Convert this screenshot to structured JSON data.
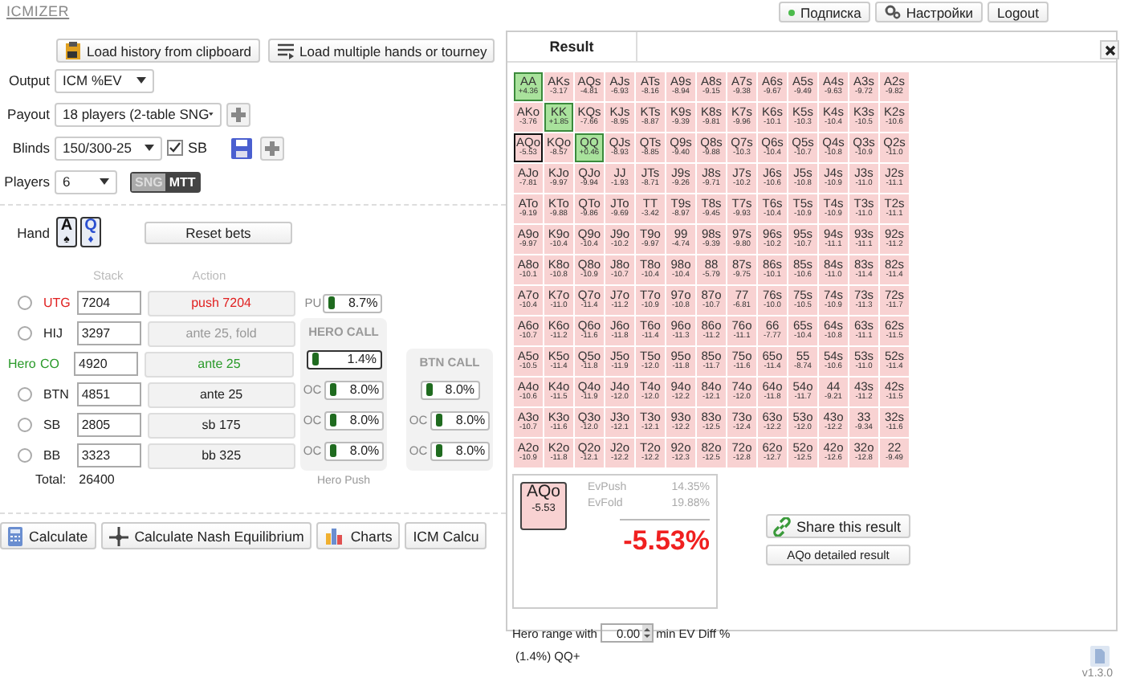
{
  "app_title": "ICMIZER",
  "top_buttons": [
    {
      "label": "Подписка",
      "kind": "status"
    },
    {
      "label": "Настройки",
      "kind": "settings"
    },
    {
      "label": "Logout",
      "kind": "plain"
    }
  ],
  "load_buttons": [
    {
      "label": "Load history from clipboard",
      "kind": "clipboard"
    },
    {
      "label": "Load multiple hands or tourney",
      "kind": "list"
    }
  ],
  "settings": {
    "output": {
      "label": "Output",
      "value": "ICM %EV"
    },
    "payout": {
      "label": "Payout",
      "value": "18 players (2-table SNG"
    },
    "blinds": {
      "label": "Blinds",
      "value": "150/300-25",
      "sb_label": "SB",
      "sb_checked": true
    },
    "players": {
      "label": "Players",
      "value": "6"
    },
    "mode": [
      {
        "label": "SNG",
        "selected": false
      },
      {
        "label": "MTT",
        "selected": true
      }
    ]
  },
  "hand": {
    "label": "Hand",
    "cards": [
      {
        "rank": "A",
        "suit": "♠",
        "color": "#111111"
      },
      {
        "rank": "Q",
        "suit": "♦",
        "color": "#2a4fd0"
      }
    ]
  },
  "reset_button": "Reset bets",
  "table_headers": {
    "stack": "Stack",
    "action": "Action"
  },
  "players": [
    {
      "position": "UTG",
      "stack": "7204",
      "action": "push 7204",
      "pushed": true,
      "folded": false,
      "selected": false
    },
    {
      "position": "HIJ",
      "stack": "3297",
      "action": "ante 25, fold",
      "pushed": false,
      "folded": true,
      "selected": false
    },
    {
      "position": "CO",
      "stack": "4920",
      "action": "ante 25",
      "pushed": false,
      "folded": false,
      "hero_label": "Hero"
    },
    {
      "position": "BTN",
      "stack": "4851",
      "action": "ante 25",
      "pushed": false,
      "folded": false,
      "selected": false
    },
    {
      "position": "SB",
      "stack": "2805",
      "action": "sb 175",
      "pushed": false,
      "folded": false,
      "selected": false
    },
    {
      "position": "BB",
      "stack": "3323",
      "action": "bb 325",
      "pushed": false,
      "folded": false,
      "selected": false
    }
  ],
  "push_indicator": {
    "label": "PU",
    "value": "8.7%"
  },
  "total": {
    "label": "Total:",
    "value": "26400"
  },
  "call_panels": [
    {
      "title": "HERO CALL",
      "footer": "Hero Push",
      "rows": [
        {
          "label": null,
          "value": "1.4%",
          "hero": true
        },
        {
          "label": "OC",
          "value": "8.0%",
          "hero": false
        },
        {
          "label": "OC",
          "value": "8.0%",
          "hero": false
        },
        {
          "label": "OC",
          "value": "8.0%",
          "hero": false
        }
      ]
    },
    {
      "title": "BTN CALL",
      "rows": [
        {
          "label": null,
          "value": "8.0%",
          "hero": false
        },
        {
          "label": "OC",
          "value": "8.0%",
          "hero": false
        },
        {
          "label": "OC",
          "value": "8.0%",
          "hero": false
        }
      ]
    }
  ],
  "bottom_buttons": [
    {
      "label": "Calculate",
      "kind": "calculator"
    },
    {
      "label": "Calculate Nash Equilibrium",
      "kind": "nash"
    },
    {
      "label": "Charts",
      "kind": "chart"
    },
    {
      "label": "ICM Calcu",
      "kind": "plain"
    }
  ],
  "result": {
    "tab": "Result",
    "grid": [
      [
        {
          "hand": "AA",
          "ev": "+4.36",
          "in_range": true,
          "selected": false
        },
        {
          "hand": "AKs",
          "ev": "-3.17",
          "in_range": false,
          "selected": false
        },
        {
          "hand": "AQs",
          "ev": "-4.81",
          "in_range": false,
          "selected": false
        },
        {
          "hand": "AJs",
          "ev": "-6.93",
          "in_range": false,
          "selected": false
        },
        {
          "hand": "ATs",
          "ev": "-8.16",
          "in_range": false,
          "selected": false
        },
        {
          "hand": "A9s",
          "ev": "-8.94",
          "in_range": false,
          "selected": false
        },
        {
          "hand": "A8s",
          "ev": "-9.15",
          "in_range": false,
          "selected": false
        },
        {
          "hand": "A7s",
          "ev": "-9.38",
          "in_range": false,
          "selected": false
        },
        {
          "hand": "A6s",
          "ev": "-9.67",
          "in_range": false,
          "selected": false
        },
        {
          "hand": "A5s",
          "ev": "-9.49",
          "in_range": false,
          "selected": false
        },
        {
          "hand": "A4s",
          "ev": "-9.63",
          "in_range": false,
          "selected": false
        },
        {
          "hand": "A3s",
          "ev": "-9.72",
          "in_range": false,
          "selected": false
        },
        {
          "hand": "A2s",
          "ev": "-9.82",
          "in_range": false,
          "selected": false
        }
      ],
      [
        {
          "hand": "AKo",
          "ev": "-3.76",
          "in_range": false,
          "selected": false
        },
        {
          "hand": "KK",
          "ev": "+1.85",
          "in_range": true,
          "selected": false
        },
        {
          "hand": "KQs",
          "ev": "-7.66",
          "in_range": false,
          "selected": false
        },
        {
          "hand": "KJs",
          "ev": "-8.95",
          "in_range": false,
          "selected": false
        },
        {
          "hand": "KTs",
          "ev": "-8.87",
          "in_range": false,
          "selected": false
        },
        {
          "hand": "K9s",
          "ev": "-9.39",
          "in_range": false,
          "selected": false
        },
        {
          "hand": "K8s",
          "ev": "-9.81",
          "in_range": false,
          "selected": false
        },
        {
          "hand": "K7s",
          "ev": "-9.96",
          "in_range": false,
          "selected": false
        },
        {
          "hand": "K6s",
          "ev": "-10.1",
          "in_range": false,
          "selected": false
        },
        {
          "hand": "K5s",
          "ev": "-10.3",
          "in_range": false,
          "selected": false
        },
        {
          "hand": "K4s",
          "ev": "-10.4",
          "in_range": false,
          "selected": false
        },
        {
          "hand": "K3s",
          "ev": "-10.5",
          "in_range": false,
          "selected": false
        },
        {
          "hand": "K2s",
          "ev": "-10.6",
          "in_range": false,
          "selected": false
        }
      ],
      [
        {
          "hand": "AQo",
          "ev": "-5.53",
          "in_range": false,
          "selected": true
        },
        {
          "hand": "KQo",
          "ev": "-8.57",
          "in_range": false,
          "selected": false
        },
        {
          "hand": "QQ",
          "ev": "+0.46",
          "in_range": true,
          "selected": false
        },
        {
          "hand": "QJs",
          "ev": "-8.93",
          "in_range": false,
          "selected": false
        },
        {
          "hand": "QTs",
          "ev": "-8.85",
          "in_range": false,
          "selected": false
        },
        {
          "hand": "Q9s",
          "ev": "-9.40",
          "in_range": false,
          "selected": false
        },
        {
          "hand": "Q8s",
          "ev": "-9.88",
          "in_range": false,
          "selected": false
        },
        {
          "hand": "Q7s",
          "ev": "-10.3",
          "in_range": false,
          "selected": false
        },
        {
          "hand": "Q6s",
          "ev": "-10.4",
          "in_range": false,
          "selected": false
        },
        {
          "hand": "Q5s",
          "ev": "-10.7",
          "in_range": false,
          "selected": false
        },
        {
          "hand": "Q4s",
          "ev": "-10.8",
          "in_range": false,
          "selected": false
        },
        {
          "hand": "Q3s",
          "ev": "-10.9",
          "in_range": false,
          "selected": false
        },
        {
          "hand": "Q2s",
          "ev": "-11.0",
          "in_range": false,
          "selected": false
        }
      ],
      [
        {
          "hand": "AJo",
          "ev": "-7.81",
          "in_range": false,
          "selected": false
        },
        {
          "hand": "KJo",
          "ev": "-9.97",
          "in_range": false,
          "selected": false
        },
        {
          "hand": "QJo",
          "ev": "-9.94",
          "in_range": false,
          "selected": false
        },
        {
          "hand": "JJ",
          "ev": "-1.93",
          "in_range": false,
          "selected": false
        },
        {
          "hand": "JTs",
          "ev": "-8.71",
          "in_range": false,
          "selected": false
        },
        {
          "hand": "J9s",
          "ev": "-9.26",
          "in_range": false,
          "selected": false
        },
        {
          "hand": "J8s",
          "ev": "-9.71",
          "in_range": false,
          "selected": false
        },
        {
          "hand": "J7s",
          "ev": "-10.2",
          "in_range": false,
          "selected": false
        },
        {
          "hand": "J6s",
          "ev": "-10.6",
          "in_range": false,
          "selected": false
        },
        {
          "hand": "J5s",
          "ev": "-10.8",
          "in_range": false,
          "selected": false
        },
        {
          "hand": "J4s",
          "ev": "-10.9",
          "in_range": false,
          "selected": false
        },
        {
          "hand": "J3s",
          "ev": "-11.0",
          "in_range": false,
          "selected": false
        },
        {
          "hand": "J2s",
          "ev": "-11.1",
          "in_range": false,
          "selected": false
        }
      ],
      [
        {
          "hand": "ATo",
          "ev": "-9.19",
          "in_range": false,
          "selected": false
        },
        {
          "hand": "KTo",
          "ev": "-9.88",
          "in_range": false,
          "selected": false
        },
        {
          "hand": "QTo",
          "ev": "-9.86",
          "in_range": false,
          "selected": false
        },
        {
          "hand": "JTo",
          "ev": "-9.69",
          "in_range": false,
          "selected": false
        },
        {
          "hand": "TT",
          "ev": "-3.42",
          "in_range": false,
          "selected": false
        },
        {
          "hand": "T9s",
          "ev": "-8.97",
          "in_range": false,
          "selected": false
        },
        {
          "hand": "T8s",
          "ev": "-9.45",
          "in_range": false,
          "selected": false
        },
        {
          "hand": "T7s",
          "ev": "-9.93",
          "in_range": false,
          "selected": false
        },
        {
          "hand": "T6s",
          "ev": "-10.4",
          "in_range": false,
          "selected": false
        },
        {
          "hand": "T5s",
          "ev": "-10.9",
          "in_range": false,
          "selected": false
        },
        {
          "hand": "T4s",
          "ev": "-10.9",
          "in_range": false,
          "selected": false
        },
        {
          "hand": "T3s",
          "ev": "-11.0",
          "in_range": false,
          "selected": false
        },
        {
          "hand": "T2s",
          "ev": "-11.1",
          "in_range": false,
          "selected": false
        }
      ],
      [
        {
          "hand": "A9o",
          "ev": "-9.97",
          "in_range": false,
          "selected": false
        },
        {
          "hand": "K9o",
          "ev": "-10.4",
          "in_range": false,
          "selected": false
        },
        {
          "hand": "Q9o",
          "ev": "-10.4",
          "in_range": false,
          "selected": false
        },
        {
          "hand": "J9o",
          "ev": "-10.2",
          "in_range": false,
          "selected": false
        },
        {
          "hand": "T9o",
          "ev": "-9.97",
          "in_range": false,
          "selected": false
        },
        {
          "hand": "99",
          "ev": "-4.74",
          "in_range": false,
          "selected": false
        },
        {
          "hand": "98s",
          "ev": "-9.39",
          "in_range": false,
          "selected": false
        },
        {
          "hand": "97s",
          "ev": "-9.80",
          "in_range": false,
          "selected": false
        },
        {
          "hand": "96s",
          "ev": "-10.2",
          "in_range": false,
          "selected": false
        },
        {
          "hand": "95s",
          "ev": "-10.7",
          "in_range": false,
          "selected": false
        },
        {
          "hand": "94s",
          "ev": "-11.1",
          "in_range": false,
          "selected": false
        },
        {
          "hand": "93s",
          "ev": "-11.1",
          "in_range": false,
          "selected": false
        },
        {
          "hand": "92s",
          "ev": "-11.2",
          "in_range": false,
          "selected": false
        }
      ],
      [
        {
          "hand": "A8o",
          "ev": "-10.1",
          "in_range": false,
          "selected": false
        },
        {
          "hand": "K8o",
          "ev": "-10.8",
          "in_range": false,
          "selected": false
        },
        {
          "hand": "Q8o",
          "ev": "-10.9",
          "in_range": false,
          "selected": false
        },
        {
          "hand": "J8o",
          "ev": "-10.7",
          "in_range": false,
          "selected": false
        },
        {
          "hand": "T8o",
          "ev": "-10.4",
          "in_range": false,
          "selected": false
        },
        {
          "hand": "98o",
          "ev": "-10.4",
          "in_range": false,
          "selected": false
        },
        {
          "hand": "88",
          "ev": "-5.79",
          "in_range": false,
          "selected": false
        },
        {
          "hand": "87s",
          "ev": "-9.75",
          "in_range": false,
          "selected": false
        },
        {
          "hand": "86s",
          "ev": "-10.1",
          "in_range": false,
          "selected": false
        },
        {
          "hand": "85s",
          "ev": "-10.6",
          "in_range": false,
          "selected": false
        },
        {
          "hand": "84s",
          "ev": "-11.0",
          "in_range": false,
          "selected": false
        },
        {
          "hand": "83s",
          "ev": "-11.4",
          "in_range": false,
          "selected": false
        },
        {
          "hand": "82s",
          "ev": "-11.4",
          "in_range": false,
          "selected": false
        }
      ],
      [
        {
          "hand": "A7o",
          "ev": "-10.4",
          "in_range": false,
          "selected": false
        },
        {
          "hand": "K7o",
          "ev": "-11.0",
          "in_range": false,
          "selected": false
        },
        {
          "hand": "Q7o",
          "ev": "-11.4",
          "in_range": false,
          "selected": false
        },
        {
          "hand": "J7o",
          "ev": "-11.2",
          "in_range": false,
          "selected": false
        },
        {
          "hand": "T7o",
          "ev": "-10.9",
          "in_range": false,
          "selected": false
        },
        {
          "hand": "97o",
          "ev": "-10.8",
          "in_range": false,
          "selected": false
        },
        {
          "hand": "87o",
          "ev": "-10.7",
          "in_range": false,
          "selected": false
        },
        {
          "hand": "77",
          "ev": "-6.81",
          "in_range": false,
          "selected": false
        },
        {
          "hand": "76s",
          "ev": "-10.0",
          "in_range": false,
          "selected": false
        },
        {
          "hand": "75s",
          "ev": "-10.5",
          "in_range": false,
          "selected": false
        },
        {
          "hand": "74s",
          "ev": "-10.9",
          "in_range": false,
          "selected": false
        },
        {
          "hand": "73s",
          "ev": "-11.3",
          "in_range": false,
          "selected": false
        },
        {
          "hand": "72s",
          "ev": "-11.7",
          "in_range": false,
          "selected": false
        }
      ],
      [
        {
          "hand": "A6o",
          "ev": "-10.7",
          "in_range": false,
          "selected": false
        },
        {
          "hand": "K6o",
          "ev": "-11.2",
          "in_range": false,
          "selected": false
        },
        {
          "hand": "Q6o",
          "ev": "-11.6",
          "in_range": false,
          "selected": false
        },
        {
          "hand": "J6o",
          "ev": "-11.8",
          "in_range": false,
          "selected": false
        },
        {
          "hand": "T6o",
          "ev": "-11.4",
          "in_range": false,
          "selected": false
        },
        {
          "hand": "96o",
          "ev": "-11.3",
          "in_range": false,
          "selected": false
        },
        {
          "hand": "86o",
          "ev": "-11.2",
          "in_range": false,
          "selected": false
        },
        {
          "hand": "76o",
          "ev": "-11.1",
          "in_range": false,
          "selected": false
        },
        {
          "hand": "66",
          "ev": "-7.77",
          "in_range": false,
          "selected": false
        },
        {
          "hand": "65s",
          "ev": "-10.4",
          "in_range": false,
          "selected": false
        },
        {
          "hand": "64s",
          "ev": "-10.8",
          "in_range": false,
          "selected": false
        },
        {
          "hand": "63s",
          "ev": "-11.1",
          "in_range": false,
          "selected": false
        },
        {
          "hand": "62s",
          "ev": "-11.5",
          "in_range": false,
          "selected": false
        }
      ],
      [
        {
          "hand": "A5o",
          "ev": "-10.5",
          "in_range": false,
          "selected": false
        },
        {
          "hand": "K5o",
          "ev": "-11.4",
          "in_range": false,
          "selected": false
        },
        {
          "hand": "Q5o",
          "ev": "-11.8",
          "in_range": false,
          "selected": false
        },
        {
          "hand": "J5o",
          "ev": "-11.9",
          "in_range": false,
          "selected": false
        },
        {
          "hand": "T5o",
          "ev": "-12.0",
          "in_range": false,
          "selected": false
        },
        {
          "hand": "95o",
          "ev": "-11.8",
          "in_range": false,
          "selected": false
        },
        {
          "hand": "85o",
          "ev": "-11.7",
          "in_range": false,
          "selected": false
        },
        {
          "hand": "75o",
          "ev": "-11.6",
          "in_range": false,
          "selected": false
        },
        {
          "hand": "65o",
          "ev": "-11.4",
          "in_range": false,
          "selected": false
        },
        {
          "hand": "55",
          "ev": "-8.74",
          "in_range": false,
          "selected": false
        },
        {
          "hand": "54s",
          "ev": "-10.6",
          "in_range": false,
          "selected": false
        },
        {
          "hand": "53s",
          "ev": "-11.0",
          "in_range": false,
          "selected": false
        },
        {
          "hand": "52s",
          "ev": "-11.4",
          "in_range": false,
          "selected": false
        }
      ],
      [
        {
          "hand": "A4o",
          "ev": "-10.6",
          "in_range": false,
          "selected": false
        },
        {
          "hand": "K4o",
          "ev": "-11.5",
          "in_range": false,
          "selected": false
        },
        {
          "hand": "Q4o",
          "ev": "-11.9",
          "in_range": false,
          "selected": false
        },
        {
          "hand": "J4o",
          "ev": "-12.0",
          "in_range": false,
          "selected": false
        },
        {
          "hand": "T4o",
          "ev": "-12.0",
          "in_range": false,
          "selected": false
        },
        {
          "hand": "94o",
          "ev": "-12.2",
          "in_range": false,
          "selected": false
        },
        {
          "hand": "84o",
          "ev": "-12.1",
          "in_range": false,
          "selected": false
        },
        {
          "hand": "74o",
          "ev": "-12.0",
          "in_range": false,
          "selected": false
        },
        {
          "hand": "64o",
          "ev": "-11.8",
          "in_range": false,
          "selected": false
        },
        {
          "hand": "54o",
          "ev": "-11.7",
          "in_range": false,
          "selected": false
        },
        {
          "hand": "44",
          "ev": "-9.21",
          "in_range": false,
          "selected": false
        },
        {
          "hand": "43s",
          "ev": "-11.2",
          "in_range": false,
          "selected": false
        },
        {
          "hand": "42s",
          "ev": "-11.5",
          "in_range": false,
          "selected": false
        }
      ],
      [
        {
          "hand": "A3o",
          "ev": "-10.7",
          "in_range": false,
          "selected": false
        },
        {
          "hand": "K3o",
          "ev": "-11.6",
          "in_range": false,
          "selected": false
        },
        {
          "hand": "Q3o",
          "ev": "-12.0",
          "in_range": false,
          "selected": false
        },
        {
          "hand": "J3o",
          "ev": "-12.1",
          "in_range": false,
          "selected": false
        },
        {
          "hand": "T3o",
          "ev": "-12.1",
          "in_range": false,
          "selected": false
        },
        {
          "hand": "93o",
          "ev": "-12.2",
          "in_range": false,
          "selected": false
        },
        {
          "hand": "83o",
          "ev": "-12.5",
          "in_range": false,
          "selected": false
        },
        {
          "hand": "73o",
          "ev": "-12.4",
          "in_range": false,
          "selected": false
        },
        {
          "hand": "63o",
          "ev": "-12.2",
          "in_range": false,
          "selected": false
        },
        {
          "hand": "53o",
          "ev": "-12.0",
          "in_range": false,
          "selected": false
        },
        {
          "hand": "43o",
          "ev": "-12.2",
          "in_range": false,
          "selected": false
        },
        {
          "hand": "33",
          "ev": "-9.34",
          "in_range": false,
          "selected": false
        },
        {
          "hand": "32s",
          "ev": "-11.6",
          "in_range": false,
          "selected": false
        }
      ],
      [
        {
          "hand": "A2o",
          "ev": "-10.9",
          "in_range": false,
          "selected": false
        },
        {
          "hand": "K2o",
          "ev": "-11.8",
          "in_range": false,
          "selected": false
        },
        {
          "hand": "Q2o",
          "ev": "-12.1",
          "in_range": false,
          "selected": false
        },
        {
          "hand": "J2o",
          "ev": "-12.2",
          "in_range": false,
          "selected": false
        },
        {
          "hand": "T2o",
          "ev": "-12.2",
          "in_range": false,
          "selected": false
        },
        {
          "hand": "92o",
          "ev": "-12.3",
          "in_range": false,
          "selected": false
        },
        {
          "hand": "82o",
          "ev": "-12.5",
          "in_range": false,
          "selected": false
        },
        {
          "hand": "72o",
          "ev": "-12.8",
          "in_range": false,
          "selected": false
        },
        {
          "hand": "62o",
          "ev": "-12.7",
          "in_range": false,
          "selected": false
        },
        {
          "hand": "52o",
          "ev": "-12.5",
          "in_range": false,
          "selected": false
        },
        {
          "hand": "42o",
          "ev": "-12.6",
          "in_range": false,
          "selected": false
        },
        {
          "hand": "32o",
          "ev": "-12.8",
          "in_range": false,
          "selected": false
        },
        {
          "hand": "22",
          "ev": "-9.49",
          "in_range": false,
          "selected": false
        }
      ]
    ],
    "summary": {
      "hand": "AQo",
      "ev": "-5.53",
      "lines": [
        {
          "label": "EvPush",
          "value": "14.35%"
        },
        {
          "label": "EvFold",
          "value": "19.88%"
        }
      ],
      "total": "-5.53%"
    },
    "share_button": "Share this result",
    "detail_button": "AQo detailed result",
    "range": {
      "label": "Hero range with",
      "value": "0.00",
      "suffix": "min EV Diff %",
      "summary": "(1.4%) QQ+"
    }
  },
  "version": "v1.3.0"
}
